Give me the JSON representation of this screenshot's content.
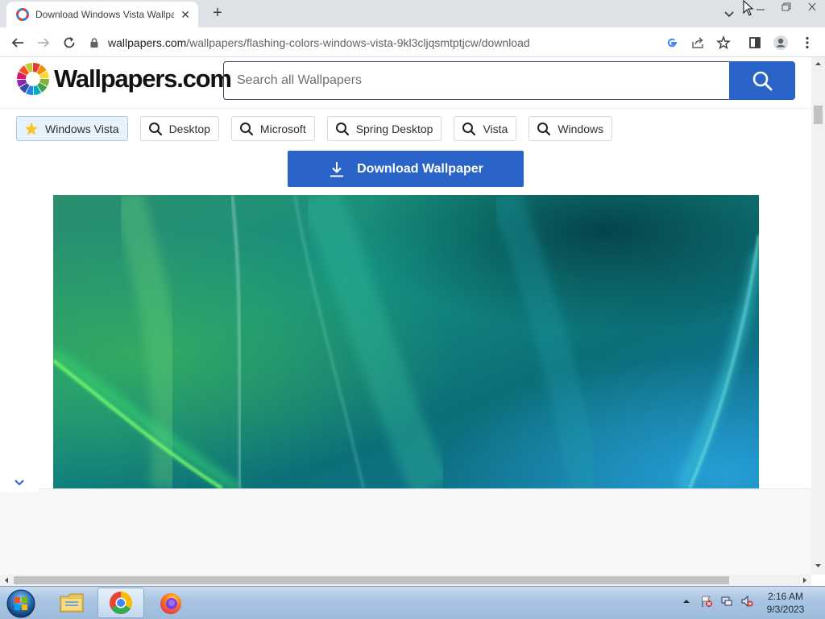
{
  "browser": {
    "tab_title": "Download Windows Vista Wallpa",
    "url_host": "wallpapers.com",
    "url_path": "/wallpapers/flashing-colors-windows-vista-9kl3cljqsmtptjcw/download"
  },
  "site": {
    "logo_text": "Wallpapers.com",
    "search_placeholder": "Search all Wallpapers",
    "tags": [
      {
        "label": "Windows Vista",
        "icon": "star-icon",
        "active": true
      },
      {
        "label": "Desktop",
        "icon": "search-icon"
      },
      {
        "label": "Microsoft",
        "icon": "search-icon"
      },
      {
        "label": "Spring Desktop",
        "icon": "search-icon"
      },
      {
        "label": "Vista",
        "icon": "search-icon"
      },
      {
        "label": "Windows",
        "icon": "search-icon"
      }
    ],
    "download_label": "Download Wallpaper"
  },
  "taskbar": {
    "time": "2:16 AM",
    "date": "9/3/2023"
  },
  "colors": {
    "brand_blue": "#2a64c8",
    "tag_active_bg": "#e8f2fb"
  }
}
